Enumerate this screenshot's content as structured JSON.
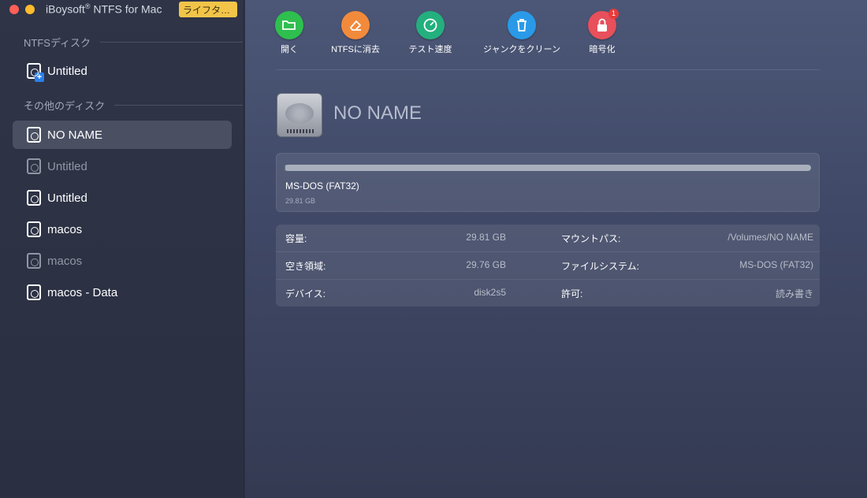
{
  "window": {
    "app_title": "iBoysoft",
    "app_title_mark": "®",
    "app_title_rest": " NTFS for Mac",
    "license_badge": "ライフタ…"
  },
  "sidebar": {
    "ntfs_section": "NTFSディスク",
    "other_section": "その他のディスク",
    "ntfs_disks": [
      {
        "label": "Untitled",
        "icon": "ntfs-disk-icon",
        "state": "active"
      }
    ],
    "other_disks": [
      {
        "label": "NO NAME",
        "icon": "disk-icon",
        "state": "selected"
      },
      {
        "label": "Untitled",
        "icon": "disk-icon",
        "state": "unmounted"
      },
      {
        "label": "Untitled",
        "icon": "disk-icon",
        "state": "active"
      },
      {
        "label": "macos",
        "icon": "disk-icon",
        "state": "active"
      },
      {
        "label": "macos",
        "icon": "disk-icon",
        "state": "unmounted"
      },
      {
        "label": "macos - Data",
        "icon": "disk-icon",
        "state": "active"
      }
    ]
  },
  "toolbar": {
    "open": {
      "label": "開く",
      "icon": "folder-open-icon",
      "color": "#2fbf4f"
    },
    "erase": {
      "label": "NTFSに消去",
      "icon": "eraser-icon",
      "color": "#f28a3c"
    },
    "speed": {
      "label": "テスト速度",
      "icon": "speedometer-icon",
      "color": "#23b07e"
    },
    "clean": {
      "label": "ジャンクをクリーン",
      "icon": "trash-icon",
      "color": "#2a9ae8"
    },
    "encrypt": {
      "label": "暗号化",
      "icon": "lock-icon",
      "color": "#e8505b",
      "badge": "1"
    }
  },
  "volume": {
    "name": "NO NAME",
    "filesystem": "MS-DOS (FAT32)",
    "size": "29.81 GB",
    "used_fraction": 0.002
  },
  "info": {
    "capacity_label": "容量:",
    "capacity_value": "29.81 GB",
    "free_label": "空き領域:",
    "free_value": "29.76 GB",
    "device_label": "デバイス:",
    "device_value": "disk2s5",
    "mount_label": "マウントパス:",
    "mount_value": "/Volumes/NO NAME",
    "fs_label": "ファイルシステム:",
    "fs_value": "MS-DOS (FAT32)",
    "perm_label": "許可:",
    "perm_value": "読み書き"
  }
}
